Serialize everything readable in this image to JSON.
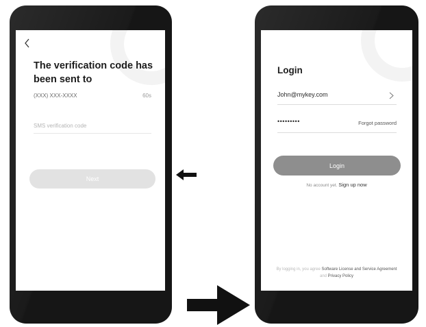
{
  "verification_screen": {
    "title": "The verification code has been sent to",
    "phone_number": "(XXX) XXX-XXXX",
    "countdown": "60s",
    "sms_placeholder": "SMS verification code",
    "next_label": "Next",
    "icons": {
      "back": "chevron-left-icon"
    }
  },
  "login_screen": {
    "title": "Login",
    "email": "John@mykey.com",
    "password_masked": "•••••••••",
    "forgot_password": "Forgot password",
    "login_label": "Login",
    "signup_prompt": "No account yet.",
    "signup_link": "Sign up now",
    "agreement_prefix": "By logging in, you agree",
    "agreement_license": "Software License and Service Agreement",
    "agreement_and": "and",
    "agreement_privacy": "Privacy Policy",
    "icons": {
      "email_chevron": "chevron-right-icon"
    }
  },
  "colors": {
    "phone_body": "#161616",
    "screen": "#ffffff",
    "next_button": "#e2e2e2",
    "login_button": "#8e8e8e",
    "deco_ring": "#f3f3f3"
  }
}
